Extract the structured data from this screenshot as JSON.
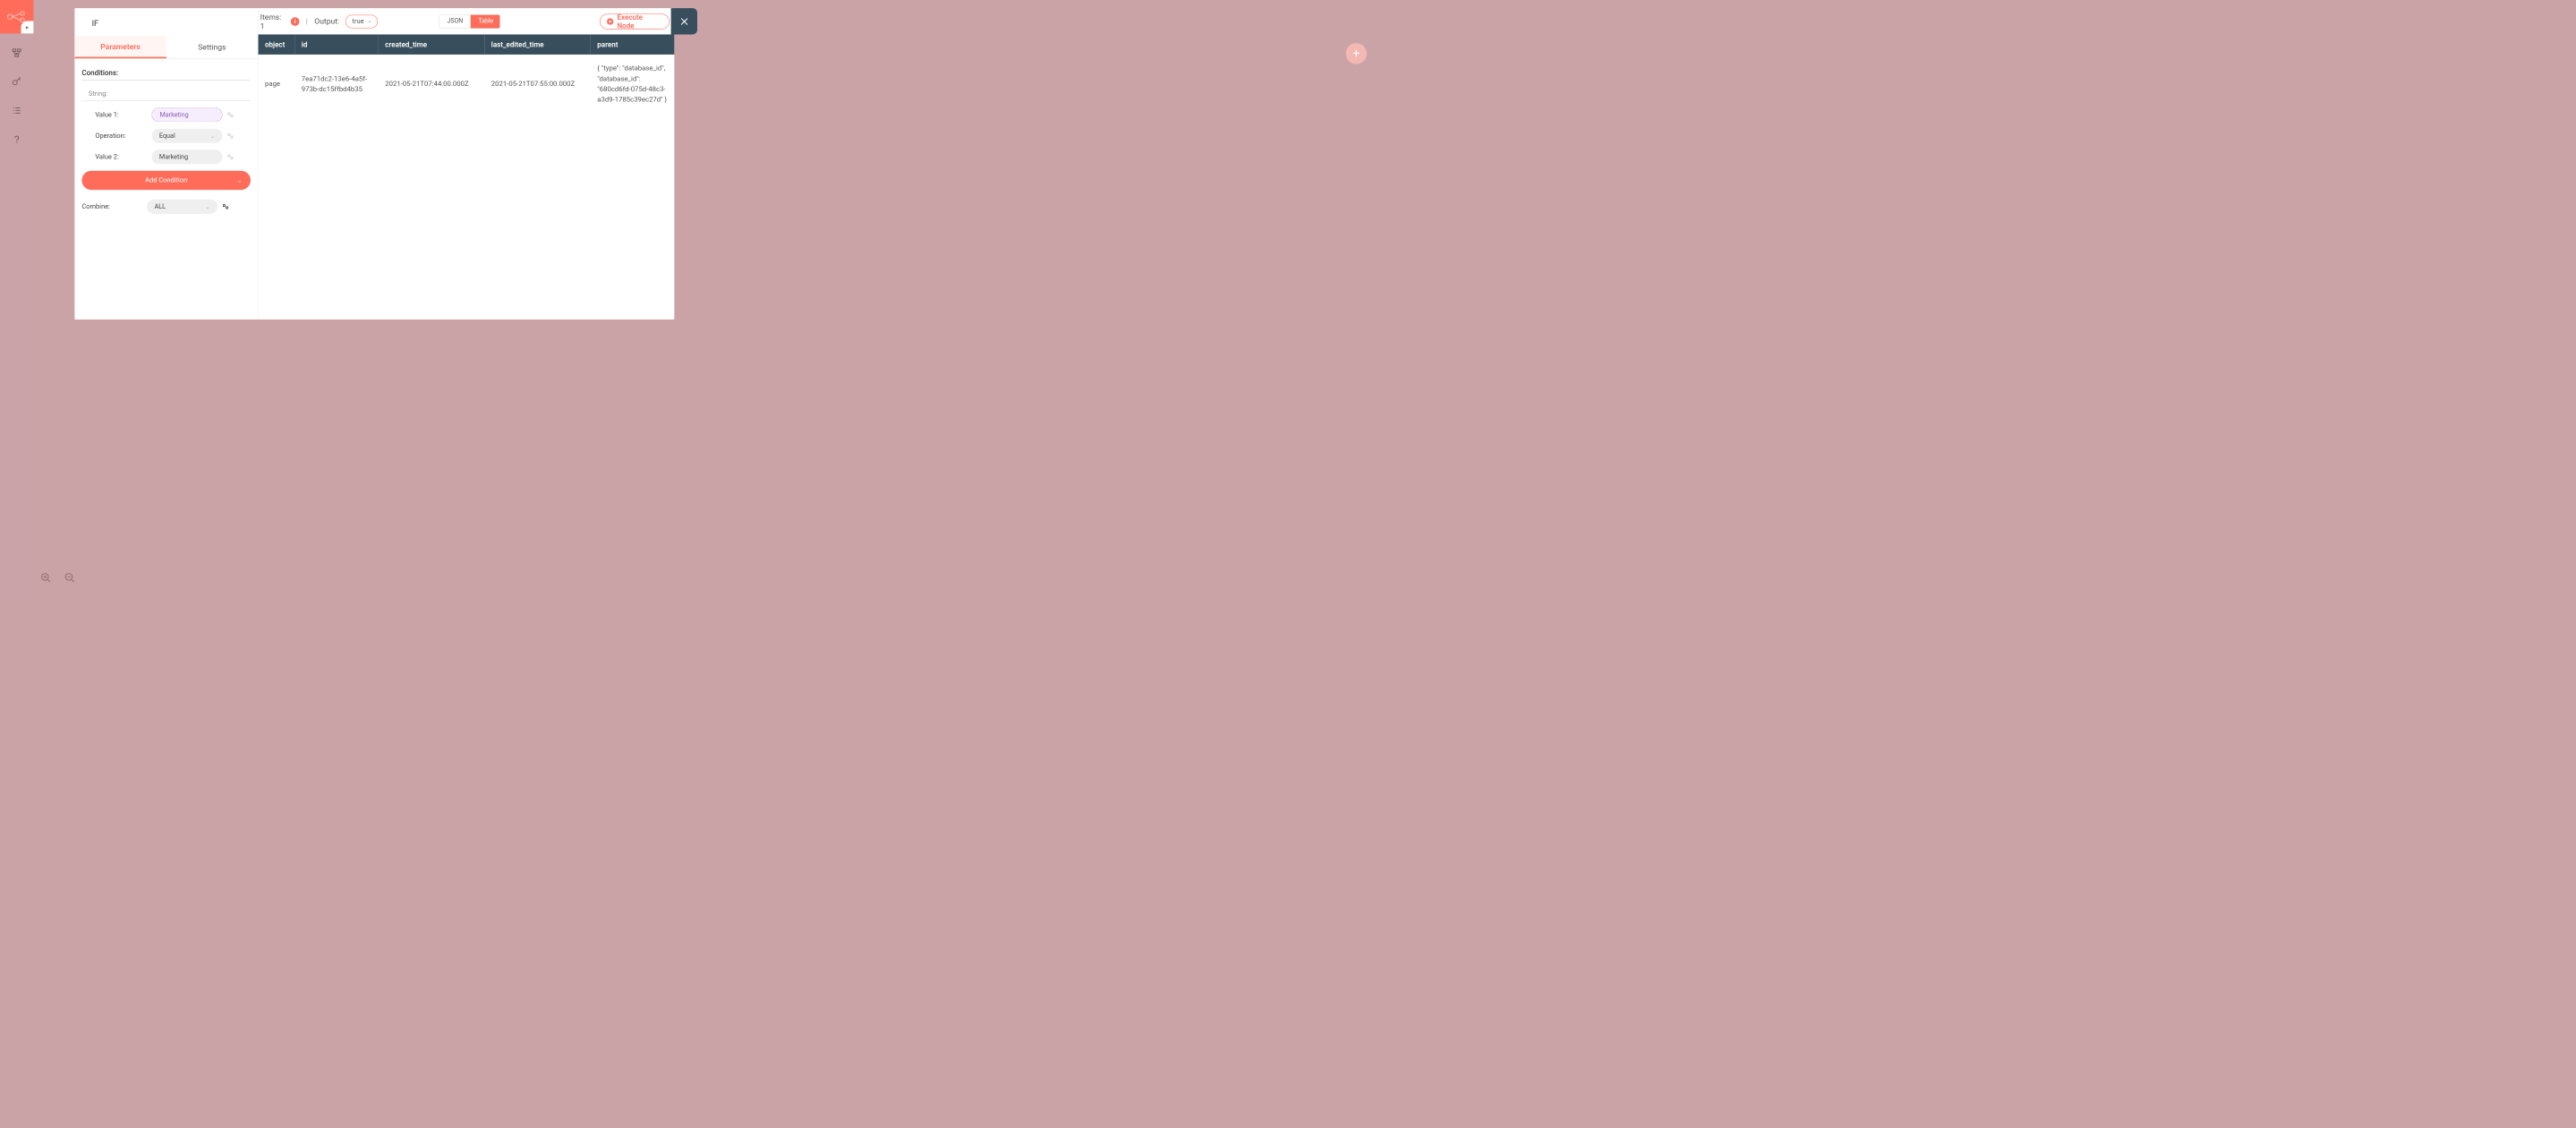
{
  "node_title": "IF",
  "tabs": {
    "parameters": "Parameters",
    "settings": "Settings"
  },
  "conditions_label": "Conditions:",
  "string_label": "String:",
  "value1": {
    "label": "Value 1:",
    "value": "Marketing"
  },
  "operation": {
    "label": "Operation:",
    "value": "Equal"
  },
  "value2": {
    "label": "Value 2:",
    "value": "Marketing"
  },
  "add_condition": "Add Condition",
  "combine": {
    "label": "Combine:",
    "value": "ALL"
  },
  "header": {
    "items_prefix": "Items: ",
    "items_count": "1",
    "output_label": "Output:",
    "output_value": "true",
    "json": "JSON",
    "table": "Table",
    "execute": "Execute Node"
  },
  "table": {
    "headers": [
      "object",
      "id",
      "created_time",
      "last_edited_time",
      "parent"
    ],
    "row": {
      "object": "page",
      "id": "7ea71dc2-13e6-4a5f-973b-dc15ffbd4b35",
      "created_time": "2021-05-21T07:44:00.000Z",
      "last_edited_time": "2021-05-21T07:55:00.000Z",
      "parent": "{ \"type\": \"database_id\", \"database_id\": \"680cd6fd-075d-48c3-a3d9-1785c39ec27d\" }"
    }
  }
}
